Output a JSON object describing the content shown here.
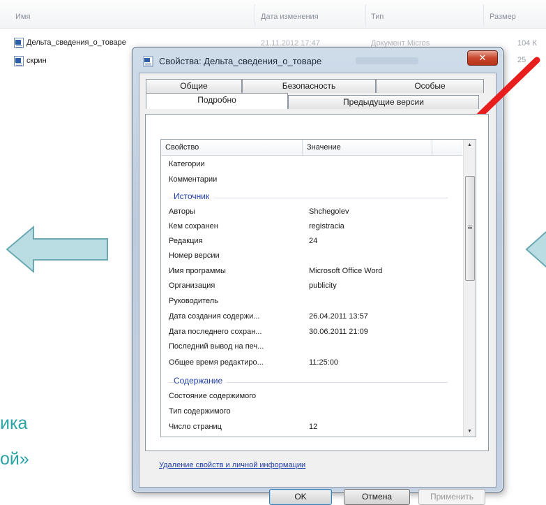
{
  "explorer": {
    "columns": [
      "Имя",
      "Дата изменения",
      "Тип",
      "Размер"
    ],
    "files": [
      {
        "name": "Дельта_сведения_о_товаре",
        "date": "21.11.2012 17:47",
        "type": "Документ Micros",
        "size": "104 К"
      },
      {
        "name": "скрин",
        "size": "25"
      }
    ]
  },
  "slide": {
    "text_line1": "ика",
    "text_line2": "ой»"
  },
  "dialog": {
    "title": "Свойства: Дельта_сведения_о_товаре",
    "close_glyph": "✕",
    "tabs_back": [
      "Общие",
      "Безопасность",
      "Особые"
    ],
    "tabs_front": [
      "Подробно",
      "Предыдущие версии"
    ],
    "list_headers": {
      "property": "Свойство",
      "value": "Значение"
    },
    "rows_top": [
      {
        "name": "Категории",
        "value": ""
      },
      {
        "name": "Комментарии",
        "value": ""
      }
    ],
    "group_source": "Источник",
    "rows_source": [
      {
        "name": "Авторы",
        "value": "Shchegolev"
      },
      {
        "name": "Кем сохранен",
        "value": "registracia"
      },
      {
        "name": "Редакция",
        "value": "24"
      },
      {
        "name": "Номер версии",
        "value": ""
      },
      {
        "name": "Имя программы",
        "value": "Microsoft Office Word"
      },
      {
        "name": "Организация",
        "value": "publicity"
      },
      {
        "name": "Руководитель",
        "value": ""
      },
      {
        "name": "Дата создания содержи...",
        "value": "26.04.2011 13:57"
      },
      {
        "name": "Дата последнего сохран...",
        "value": "30.06.2011 21:09"
      },
      {
        "name": "Последний вывод на печ...",
        "value": ""
      },
      {
        "name": "Общее время редактиро...",
        "value": "11:25:00"
      }
    ],
    "group_content": "Содержание",
    "rows_content": [
      {
        "name": "Состояние содержимого",
        "value": ""
      },
      {
        "name": "Тип содержимого",
        "value": ""
      },
      {
        "name": "Число страниц",
        "value": "12"
      }
    ],
    "remove_link": "Удаление свойств и личной информации",
    "buttons": {
      "ok": "OK",
      "cancel": "Отмена",
      "apply": "Применить"
    }
  },
  "annotation_colors": {
    "arrow": "#e81e1e",
    "circle": "#d8222a",
    "side_arrows": "#9cc9d0"
  }
}
